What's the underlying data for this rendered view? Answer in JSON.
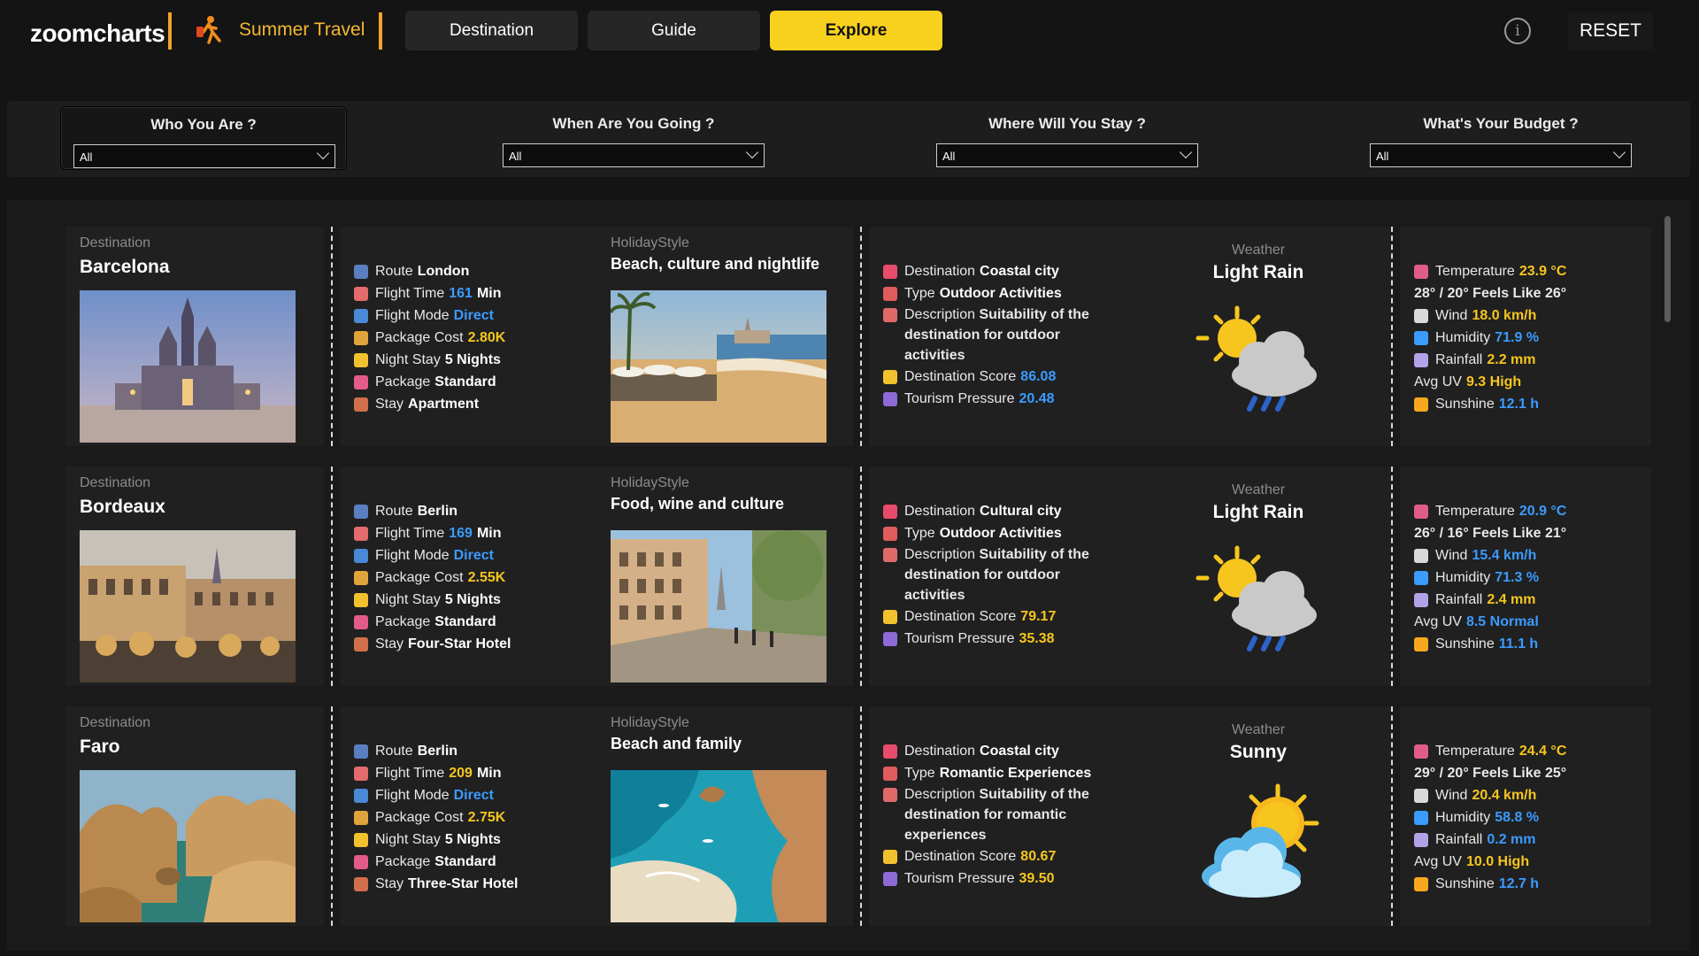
{
  "header": {
    "logo_text": "zoomcharts",
    "app_title": "Summer Travel",
    "tabs": [
      "Destination",
      "Guide",
      "Explore"
    ],
    "active_tab": "Explore",
    "reset_label": "RESET",
    "info_symbol": "i"
  },
  "filters": [
    {
      "label": "Who You Are ?",
      "value": "All"
    },
    {
      "label": "When Are You Going ?",
      "value": "All"
    },
    {
      "label": "Where Will You Stay ?",
      "value": "All"
    },
    {
      "label": "What's Your Budget ?",
      "value": "All"
    }
  ],
  "labels": {
    "destination": "Destination",
    "holiday_style": "HolidayStyle",
    "weather": "Weather",
    "route": "Route",
    "flight_time": "Flight Time",
    "flight_mode": "Flight Mode",
    "package_cost": "Package Cost",
    "night_stay": "Night Stay",
    "package": "Package",
    "stay": "Stay",
    "dest_type": "Destination",
    "type": "Type",
    "description": "Description",
    "dest_score": "Destination Score",
    "tourism_pressure": "Tourism Pressure",
    "temperature": "Temperature",
    "wind": "Wind",
    "humidity": "Humidity",
    "rainfall": "Rainfall",
    "avg_uv": "Avg UV",
    "sunshine": "Sunshine",
    "min": "Min"
  },
  "destinations": [
    {
      "name": "Barcelona",
      "route": "London",
      "flight_time": "161",
      "flight_mode": "Direct",
      "package_cost": "2.80K",
      "night_stay": "5 Nights",
      "package": "Standard",
      "stay": "Apartment",
      "holiday_style": "Beach, culture and nightlife",
      "dest_type": "Coastal city",
      "type": "Outdoor Activities",
      "description": "Suitability of the destination for outdoor activities",
      "dest_score": "86.08",
      "tourism_pressure": "20.48",
      "weather": "Light Rain",
      "weather_icon": "sun-rain-cloud",
      "temperature": "23.9 °C",
      "feels": "28° / 20° Feels Like 26°",
      "wind": "18.0 km/h",
      "humidity": "71.9 %",
      "rainfall": "2.2 mm",
      "avg_uv": "9.3 High",
      "sunshine": "12.1 h",
      "colors": {
        "flight_time": "#3b9bff",
        "package_cost": "#f7c61e",
        "dest_score": "#3b9bff",
        "tourism_pressure": "#3b9bff",
        "temperature": "#f7c61e",
        "wind": "#f7c61e",
        "humidity": "#3b9bff",
        "rainfall": "#f7c61e",
        "avg_uv": "#f7c61e",
        "sunshine": "#3b9bff"
      }
    },
    {
      "name": "Bordeaux",
      "route": "Berlin",
      "flight_time": "169",
      "flight_mode": "Direct",
      "package_cost": "2.55K",
      "night_stay": "5 Nights",
      "package": "Standard",
      "stay": "Four-Star Hotel",
      "holiday_style": "Food, wine and culture",
      "dest_type": "Cultural city",
      "type": "Outdoor Activities",
      "description": "Suitability of the destination for outdoor activities",
      "dest_score": "79.17",
      "tourism_pressure": "35.38",
      "weather": "Light Rain",
      "weather_icon": "sun-rain-cloud",
      "temperature": "20.9 °C",
      "feels": "26° / 16° Feels Like 21°",
      "wind": "15.4 km/h",
      "humidity": "71.3 %",
      "rainfall": "2.4 mm",
      "avg_uv": "8.5 Normal",
      "sunshine": "11.1 h",
      "colors": {
        "flight_time": "#3b9bff",
        "package_cost": "#f7c61e",
        "dest_score": "#f7c61e",
        "tourism_pressure": "#f7c61e",
        "temperature": "#3b9bff",
        "wind": "#3b9bff",
        "humidity": "#3b9bff",
        "rainfall": "#f7c61e",
        "avg_uv": "#3b9bff",
        "sunshine": "#3b9bff"
      }
    },
    {
      "name": "Faro",
      "route": "Berlin",
      "flight_time": "209",
      "flight_mode": "Direct",
      "package_cost": "2.75K",
      "night_stay": "5 Nights",
      "package": "Standard",
      "stay": "Three-Star Hotel",
      "holiday_style": "Beach and family",
      "dest_type": "Coastal city",
      "type": "Romantic Experiences",
      "description": "Suitability of the destination for romantic experiences",
      "dest_score": "80.67",
      "tourism_pressure": "39.50",
      "weather": "Sunny",
      "weather_icon": "sun-cloud",
      "temperature": "24.4 °C",
      "feels": "29° / 20° Feels Like 25°",
      "wind": "20.4 km/h",
      "humidity": "58.8 %",
      "rainfall": "0.2 mm",
      "avg_uv": "10.0 High",
      "sunshine": "12.7 h",
      "colors": {
        "flight_time": "#f7c61e",
        "package_cost": "#f7c61e",
        "dest_score": "#f7c61e",
        "tourism_pressure": "#f7c61e",
        "temperature": "#f7c61e",
        "wind": "#f7c61e",
        "humidity": "#3b9bff",
        "rainfall": "#3b9bff",
        "avg_uv": "#f7c61e",
        "sunshine": "#3b9bff"
      }
    }
  ]
}
